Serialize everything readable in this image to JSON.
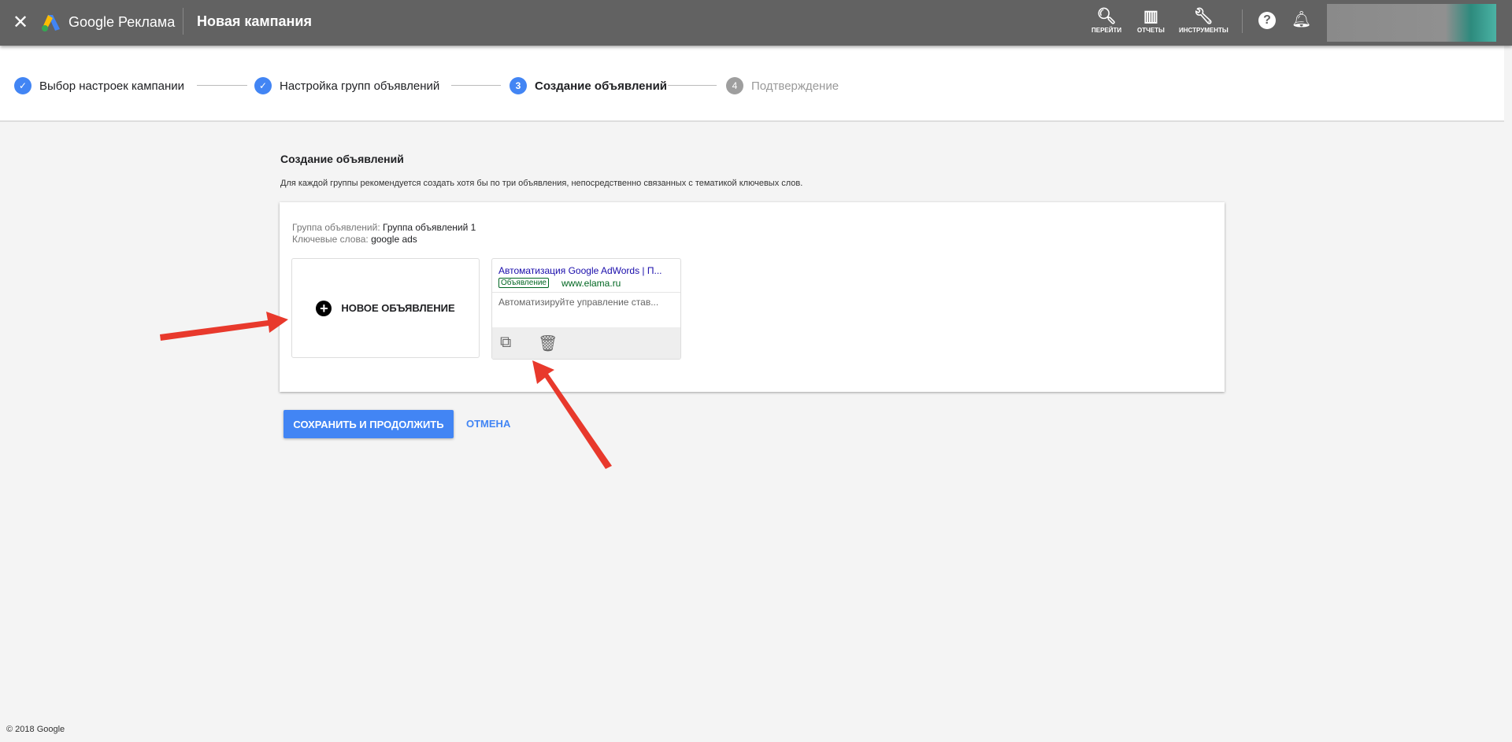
{
  "header": {
    "close_icon": "close-icon",
    "brand": "Google Реклама",
    "title": "Новая кампания",
    "tools": [
      {
        "icon": "search-icon",
        "label": "ПЕРЕЙТИ"
      },
      {
        "icon": "bar-chart-icon",
        "label": "ОТЧЕТЫ"
      },
      {
        "icon": "wrench-icon",
        "label": "ИНСТРУМЕНТЫ"
      }
    ]
  },
  "stepper": {
    "steps": [
      {
        "label": "Выбор настроек кампании",
        "state": "done"
      },
      {
        "label": "Настройка групп объявлений",
        "state": "done"
      },
      {
        "number": "3",
        "label": "Создание объявлений",
        "state": "active"
      },
      {
        "number": "4",
        "label": "Подтверждение",
        "state": "pending"
      }
    ]
  },
  "main": {
    "title": "Создание объявлений",
    "description": "Для каждой группы рекомендуется создать хотя бы по три объявления, непосредственно связанных с тематикой ключевых слов.",
    "ad_group_label": "Группа объявлений:",
    "ad_group_value": "Группа объявлений 1",
    "keywords_label": "Ключевые слова:",
    "keywords_value": "google ads",
    "new_ad_label": "НОВОЕ ОБЪЯВЛЕНИЕ",
    "ad": {
      "headline": "Автоматизация Google AdWords | П...",
      "badge": "Объявление",
      "url": "www.elama.ru",
      "description": "Автоматизируйте управление став..."
    },
    "save_label": "СОХРАНИТЬ И ПРОДОЛЖИТЬ",
    "cancel_label": "ОТМЕНА"
  },
  "footer": {
    "copyright": "© 2018 Google"
  },
  "colors": {
    "header": "#626262",
    "accent": "#4285f4",
    "annotation_arrow": "#e8392c"
  }
}
